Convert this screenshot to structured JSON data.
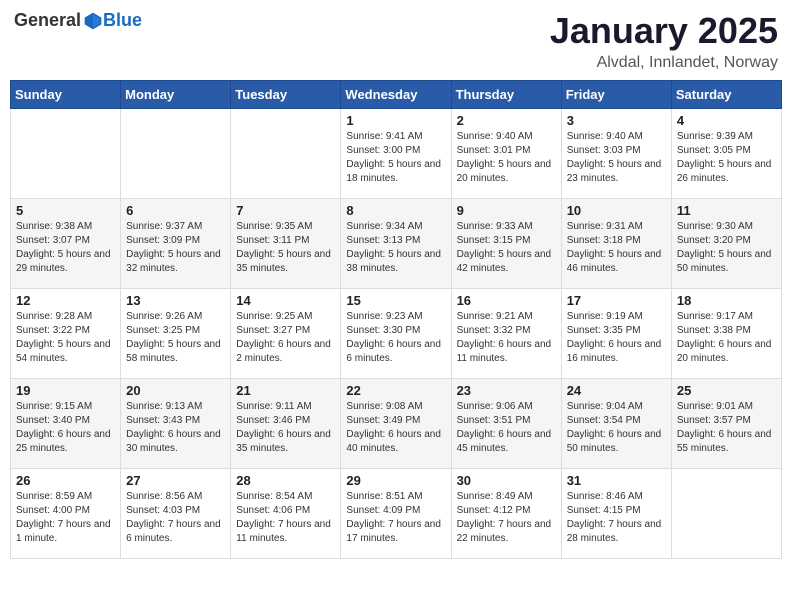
{
  "header": {
    "logo": {
      "general": "General",
      "blue": "Blue"
    },
    "title": "January 2025",
    "location": "Alvdal, Innlandet, Norway"
  },
  "calendar": {
    "weekdays": [
      "Sunday",
      "Monday",
      "Tuesday",
      "Wednesday",
      "Thursday",
      "Friday",
      "Saturday"
    ],
    "weeks": [
      [
        {
          "day": "",
          "sunrise": "",
          "sunset": "",
          "daylight": ""
        },
        {
          "day": "",
          "sunrise": "",
          "sunset": "",
          "daylight": ""
        },
        {
          "day": "",
          "sunrise": "",
          "sunset": "",
          "daylight": ""
        },
        {
          "day": "1",
          "sunrise": "Sunrise: 9:41 AM",
          "sunset": "Sunset: 3:00 PM",
          "daylight": "Daylight: 5 hours and 18 minutes."
        },
        {
          "day": "2",
          "sunrise": "Sunrise: 9:40 AM",
          "sunset": "Sunset: 3:01 PM",
          "daylight": "Daylight: 5 hours and 20 minutes."
        },
        {
          "day": "3",
          "sunrise": "Sunrise: 9:40 AM",
          "sunset": "Sunset: 3:03 PM",
          "daylight": "Daylight: 5 hours and 23 minutes."
        },
        {
          "day": "4",
          "sunrise": "Sunrise: 9:39 AM",
          "sunset": "Sunset: 3:05 PM",
          "daylight": "Daylight: 5 hours and 26 minutes."
        }
      ],
      [
        {
          "day": "5",
          "sunrise": "Sunrise: 9:38 AM",
          "sunset": "Sunset: 3:07 PM",
          "daylight": "Daylight: 5 hours and 29 minutes."
        },
        {
          "day": "6",
          "sunrise": "Sunrise: 9:37 AM",
          "sunset": "Sunset: 3:09 PM",
          "daylight": "Daylight: 5 hours and 32 minutes."
        },
        {
          "day": "7",
          "sunrise": "Sunrise: 9:35 AM",
          "sunset": "Sunset: 3:11 PM",
          "daylight": "Daylight: 5 hours and 35 minutes."
        },
        {
          "day": "8",
          "sunrise": "Sunrise: 9:34 AM",
          "sunset": "Sunset: 3:13 PM",
          "daylight": "Daylight: 5 hours and 38 minutes."
        },
        {
          "day": "9",
          "sunrise": "Sunrise: 9:33 AM",
          "sunset": "Sunset: 3:15 PM",
          "daylight": "Daylight: 5 hours and 42 minutes."
        },
        {
          "day": "10",
          "sunrise": "Sunrise: 9:31 AM",
          "sunset": "Sunset: 3:18 PM",
          "daylight": "Daylight: 5 hours and 46 minutes."
        },
        {
          "day": "11",
          "sunrise": "Sunrise: 9:30 AM",
          "sunset": "Sunset: 3:20 PM",
          "daylight": "Daylight: 5 hours and 50 minutes."
        }
      ],
      [
        {
          "day": "12",
          "sunrise": "Sunrise: 9:28 AM",
          "sunset": "Sunset: 3:22 PM",
          "daylight": "Daylight: 5 hours and 54 minutes."
        },
        {
          "day": "13",
          "sunrise": "Sunrise: 9:26 AM",
          "sunset": "Sunset: 3:25 PM",
          "daylight": "Daylight: 5 hours and 58 minutes."
        },
        {
          "day": "14",
          "sunrise": "Sunrise: 9:25 AM",
          "sunset": "Sunset: 3:27 PM",
          "daylight": "Daylight: 6 hours and 2 minutes."
        },
        {
          "day": "15",
          "sunrise": "Sunrise: 9:23 AM",
          "sunset": "Sunset: 3:30 PM",
          "daylight": "Daylight: 6 hours and 6 minutes."
        },
        {
          "day": "16",
          "sunrise": "Sunrise: 9:21 AM",
          "sunset": "Sunset: 3:32 PM",
          "daylight": "Daylight: 6 hours and 11 minutes."
        },
        {
          "day": "17",
          "sunrise": "Sunrise: 9:19 AM",
          "sunset": "Sunset: 3:35 PM",
          "daylight": "Daylight: 6 hours and 16 minutes."
        },
        {
          "day": "18",
          "sunrise": "Sunrise: 9:17 AM",
          "sunset": "Sunset: 3:38 PM",
          "daylight": "Daylight: 6 hours and 20 minutes."
        }
      ],
      [
        {
          "day": "19",
          "sunrise": "Sunrise: 9:15 AM",
          "sunset": "Sunset: 3:40 PM",
          "daylight": "Daylight: 6 hours and 25 minutes."
        },
        {
          "day": "20",
          "sunrise": "Sunrise: 9:13 AM",
          "sunset": "Sunset: 3:43 PM",
          "daylight": "Daylight: 6 hours and 30 minutes."
        },
        {
          "day": "21",
          "sunrise": "Sunrise: 9:11 AM",
          "sunset": "Sunset: 3:46 PM",
          "daylight": "Daylight: 6 hours and 35 minutes."
        },
        {
          "day": "22",
          "sunrise": "Sunrise: 9:08 AM",
          "sunset": "Sunset: 3:49 PM",
          "daylight": "Daylight: 6 hours and 40 minutes."
        },
        {
          "day": "23",
          "sunrise": "Sunrise: 9:06 AM",
          "sunset": "Sunset: 3:51 PM",
          "daylight": "Daylight: 6 hours and 45 minutes."
        },
        {
          "day": "24",
          "sunrise": "Sunrise: 9:04 AM",
          "sunset": "Sunset: 3:54 PM",
          "daylight": "Daylight: 6 hours and 50 minutes."
        },
        {
          "day": "25",
          "sunrise": "Sunrise: 9:01 AM",
          "sunset": "Sunset: 3:57 PM",
          "daylight": "Daylight: 6 hours and 55 minutes."
        }
      ],
      [
        {
          "day": "26",
          "sunrise": "Sunrise: 8:59 AM",
          "sunset": "Sunset: 4:00 PM",
          "daylight": "Daylight: 7 hours and 1 minute."
        },
        {
          "day": "27",
          "sunrise": "Sunrise: 8:56 AM",
          "sunset": "Sunset: 4:03 PM",
          "daylight": "Daylight: 7 hours and 6 minutes."
        },
        {
          "day": "28",
          "sunrise": "Sunrise: 8:54 AM",
          "sunset": "Sunset: 4:06 PM",
          "daylight": "Daylight: 7 hours and 11 minutes."
        },
        {
          "day": "29",
          "sunrise": "Sunrise: 8:51 AM",
          "sunset": "Sunset: 4:09 PM",
          "daylight": "Daylight: 7 hours and 17 minutes."
        },
        {
          "day": "30",
          "sunrise": "Sunrise: 8:49 AM",
          "sunset": "Sunset: 4:12 PM",
          "daylight": "Daylight: 7 hours and 22 minutes."
        },
        {
          "day": "31",
          "sunrise": "Sunrise: 8:46 AM",
          "sunset": "Sunset: 4:15 PM",
          "daylight": "Daylight: 7 hours and 28 minutes."
        },
        {
          "day": "",
          "sunrise": "",
          "sunset": "",
          "daylight": ""
        }
      ]
    ]
  }
}
